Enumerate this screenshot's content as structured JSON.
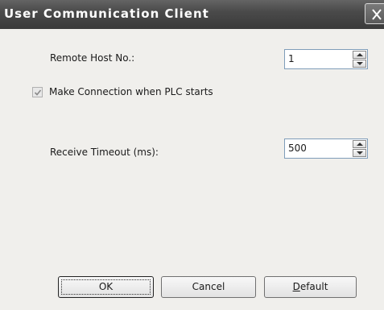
{
  "window": {
    "title": "User Communication Client"
  },
  "fields": {
    "remote_host": {
      "label": "Remote Host No.:",
      "value": "1"
    },
    "make_connection": {
      "label": "Make Connection when PLC starts",
      "checked": true,
      "disabled": true
    },
    "receive_timeout": {
      "label": "Receive Timeout (ms):",
      "value": "500"
    }
  },
  "buttons": {
    "ok": "OK",
    "cancel": "Cancel",
    "default_mnemonic": "D",
    "default_rest": "efault"
  },
  "icons": {
    "close": "close-icon",
    "check": "checkmark-icon",
    "spin_up": "arrow-up-icon",
    "spin_down": "arrow-down-icon"
  }
}
